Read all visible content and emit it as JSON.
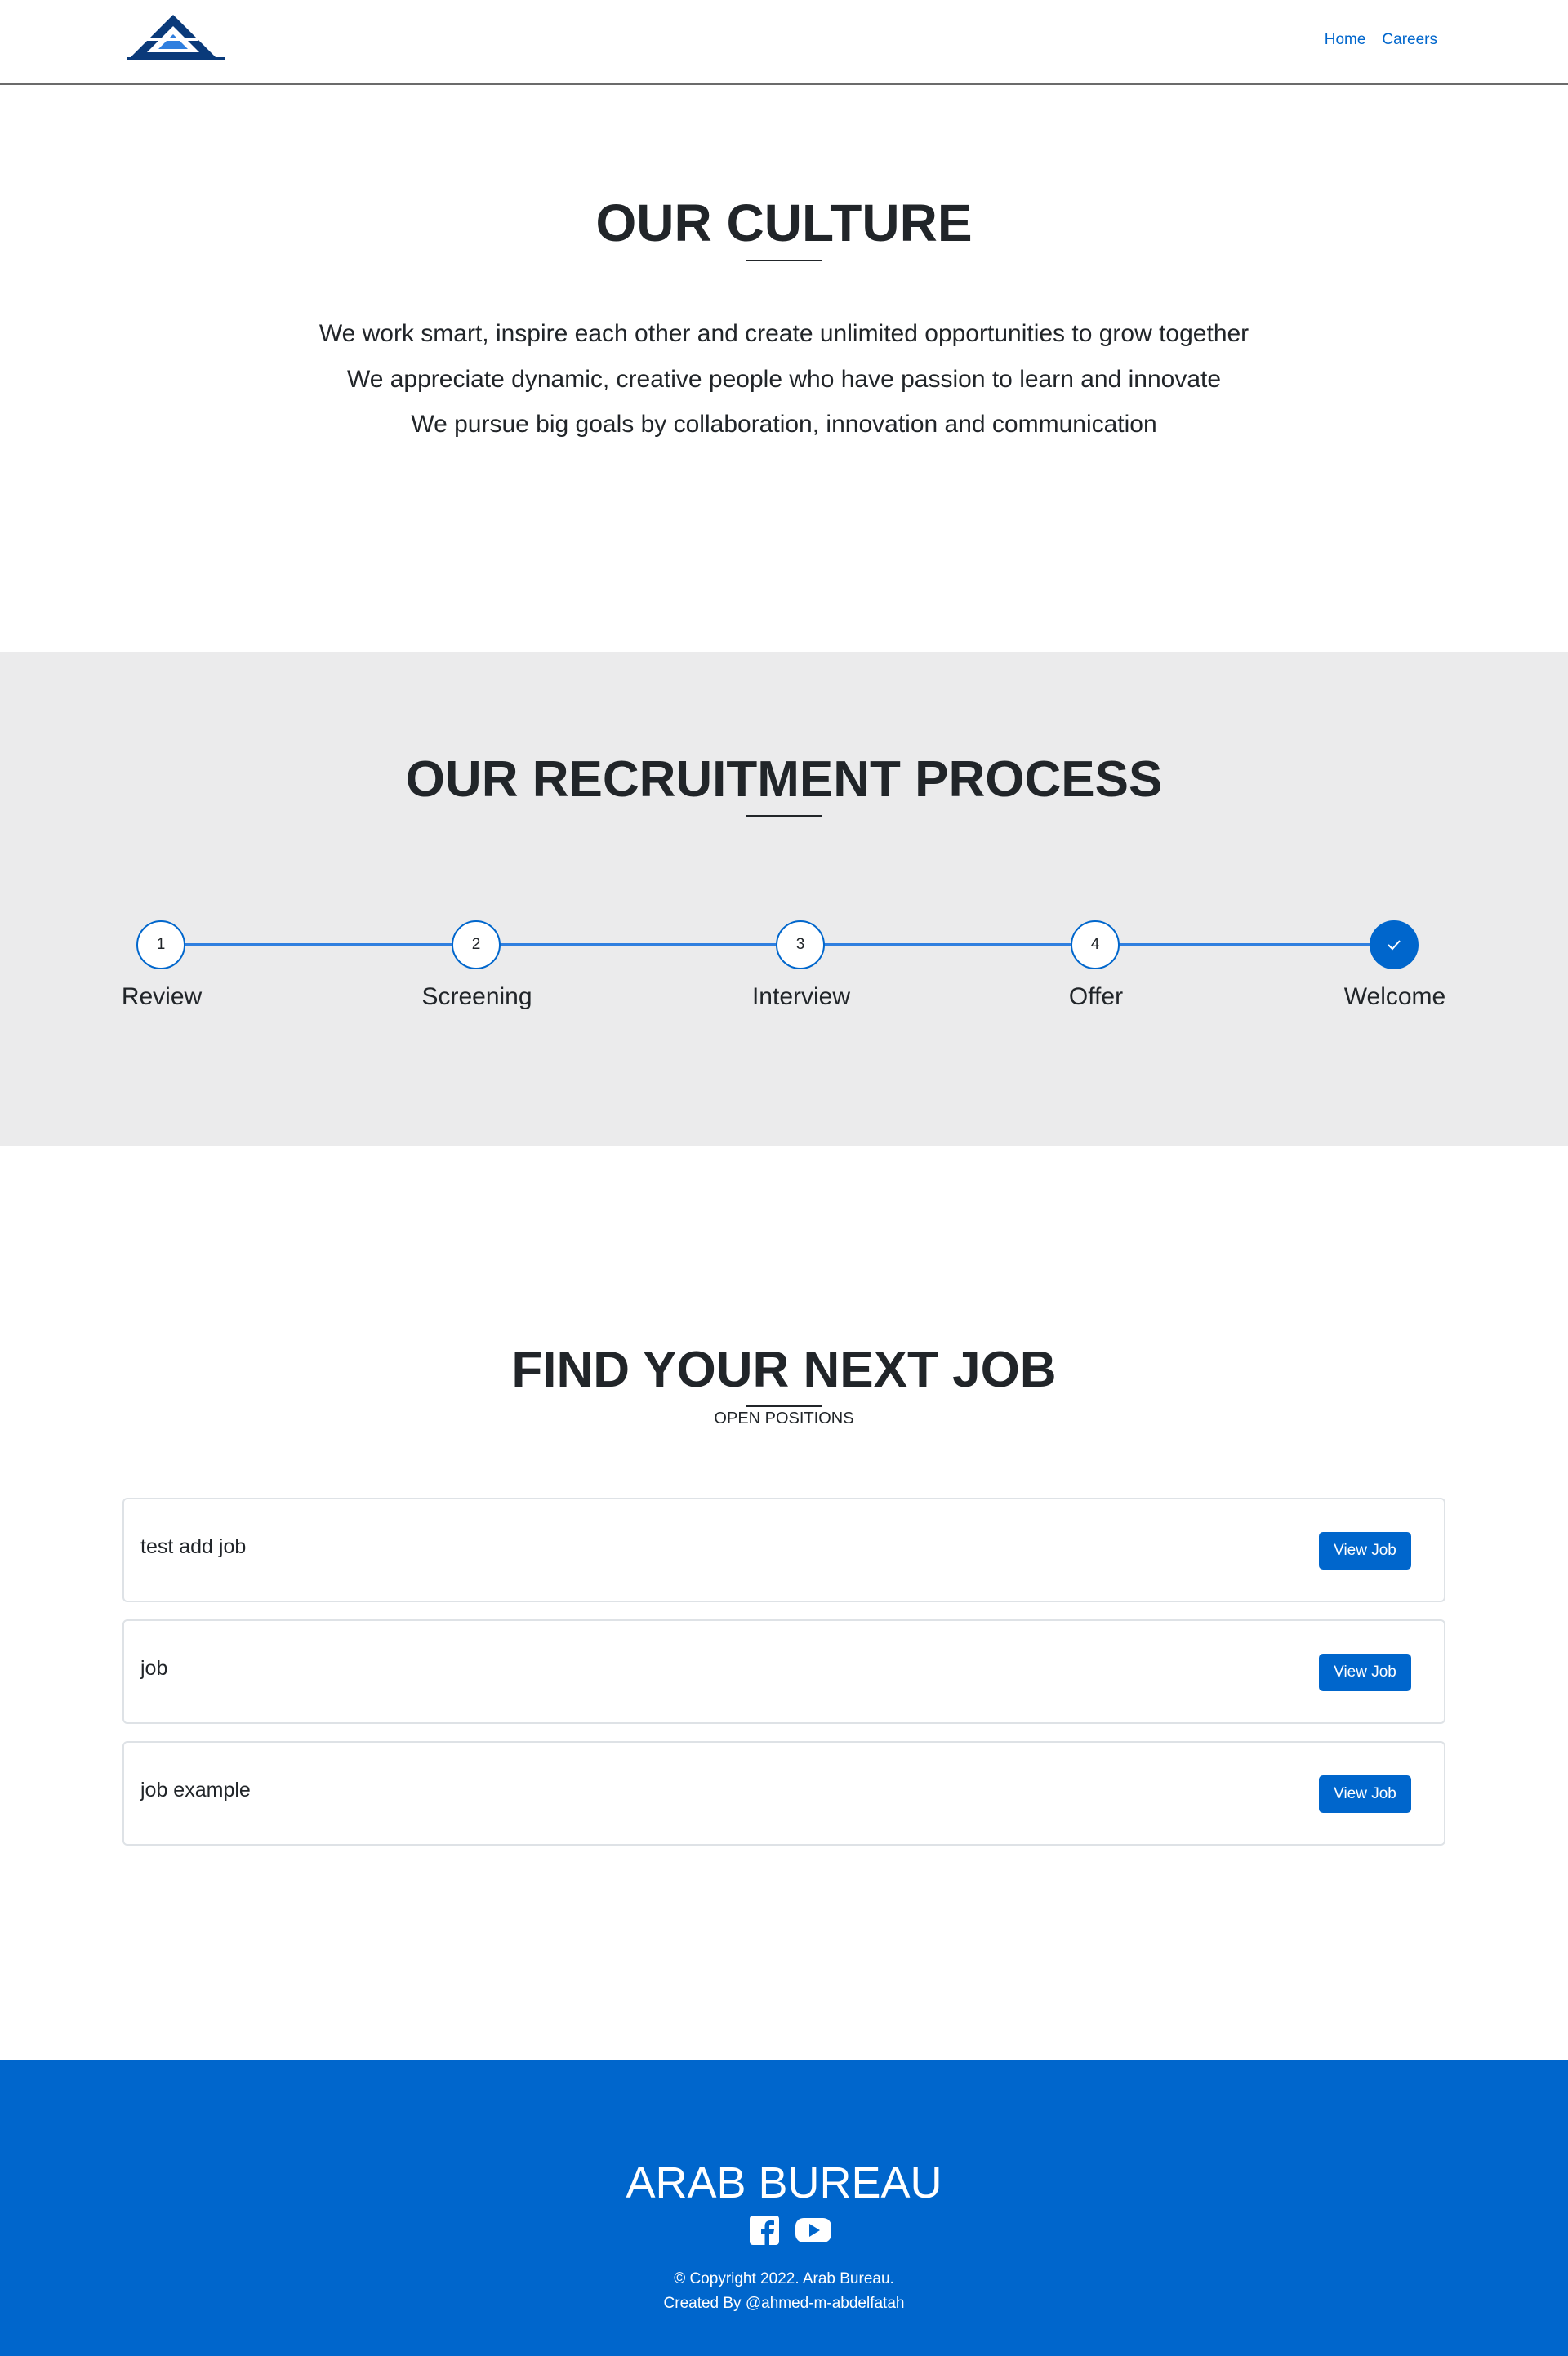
{
  "nav": {
    "home": "Home",
    "careers": "Careers"
  },
  "culture": {
    "title": "OUR CULTURE",
    "lines": [
      "We work smart, inspire each other and create unlimited opportunities to grow together",
      "We appreciate dynamic, creative people who have passion to learn and innovate",
      "We pursue big goals by collaboration, innovation and communication"
    ]
  },
  "process": {
    "title": "OUR RECRUITMENT PROCESS",
    "steps": [
      {
        "number": "1",
        "label": "Review"
      },
      {
        "number": "2",
        "label": "Screening"
      },
      {
        "number": "3",
        "label": "Interview"
      },
      {
        "number": "4",
        "label": "Offer"
      },
      {
        "number": "",
        "label": "Welcome",
        "icon": "check-icon"
      }
    ],
    "accent_color": "#0066cc"
  },
  "jobs": {
    "title": "FIND YOUR NEXT JOB",
    "subtitle": "OPEN POSITIONS",
    "items": [
      {
        "title": "test add job",
        "button": "View Job"
      },
      {
        "title": "job",
        "button": "View Job"
      },
      {
        "title": "job example",
        "button": "View Job"
      }
    ]
  },
  "footer": {
    "brand": "ARAB BUREAU",
    "copyright": "© Copyright 2022. Arab Bureau.",
    "credit_prefix": "Created By ",
    "credit_link": "@ahmed-m-abdelfatah",
    "social": [
      "facebook-icon",
      "youtube-icon"
    ],
    "background_color": "#0066cc"
  }
}
